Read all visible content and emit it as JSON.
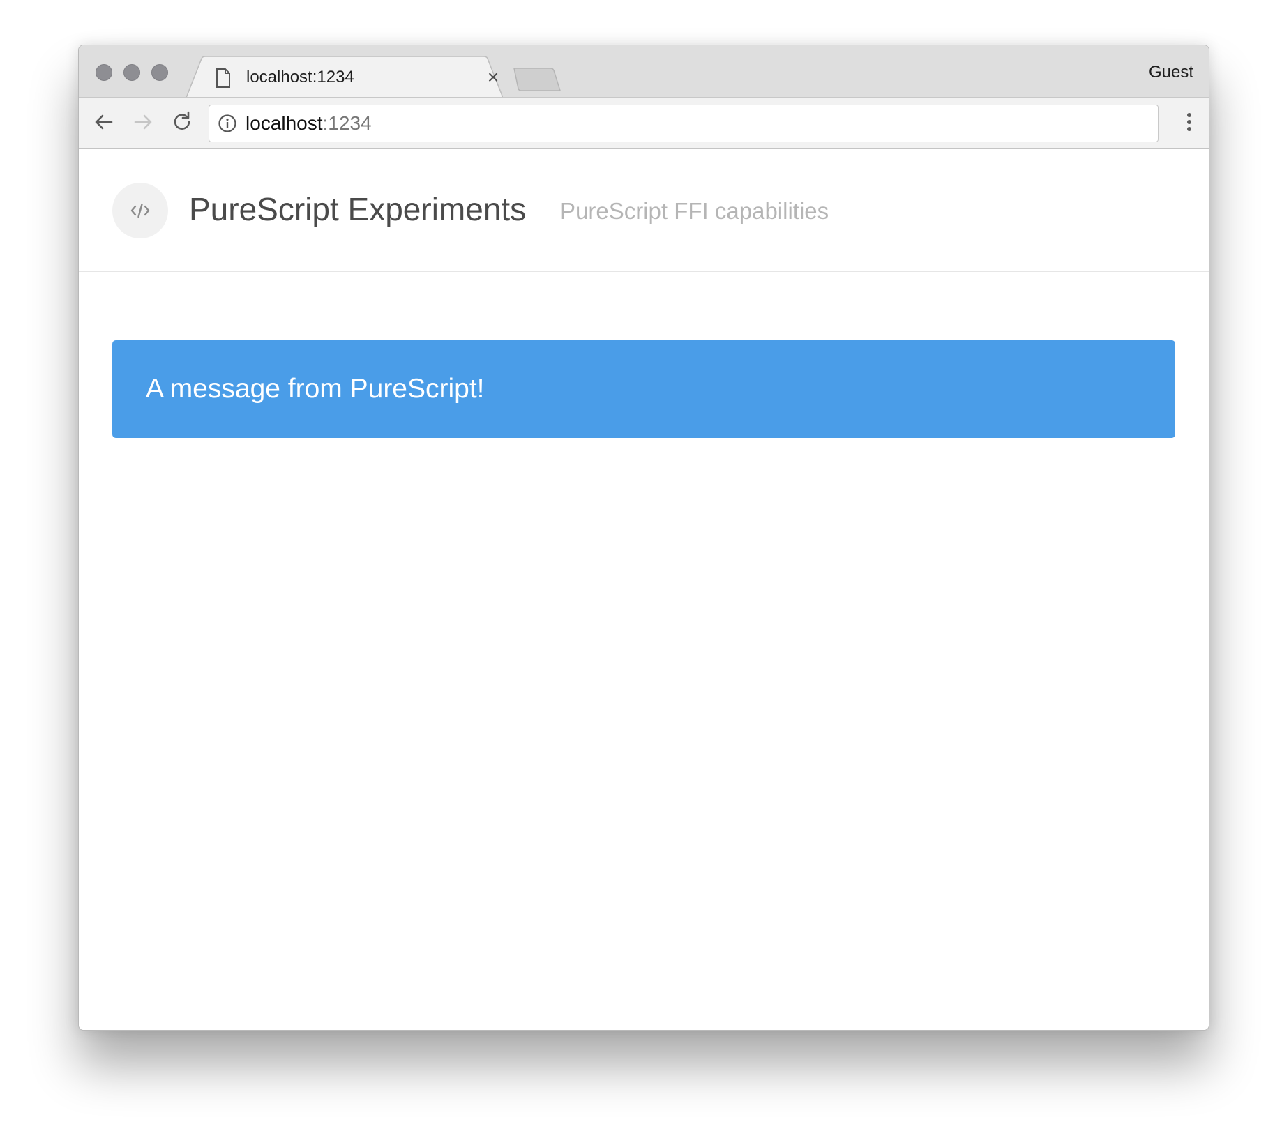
{
  "browser": {
    "tab": {
      "title": "localhost:1234",
      "close_glyph": "×",
      "icon": "file-icon"
    },
    "profile_label": "Guest",
    "address_bar": {
      "host": "localhost",
      "port": ":1234",
      "icon": "info-icon"
    },
    "toolbar_icons": [
      "back-arrow-icon",
      "forward-arrow-icon",
      "reload-icon",
      "more-vertical-icon"
    ],
    "window_buttons": [
      "close",
      "minimize",
      "zoom"
    ]
  },
  "page": {
    "logo_icon": "code-icon",
    "title": "PureScript Experiments",
    "subtitle": "PureScript FFI capabilities",
    "notification": {
      "text": "A message from PureScript!",
      "color": "#4a9de8"
    }
  }
}
